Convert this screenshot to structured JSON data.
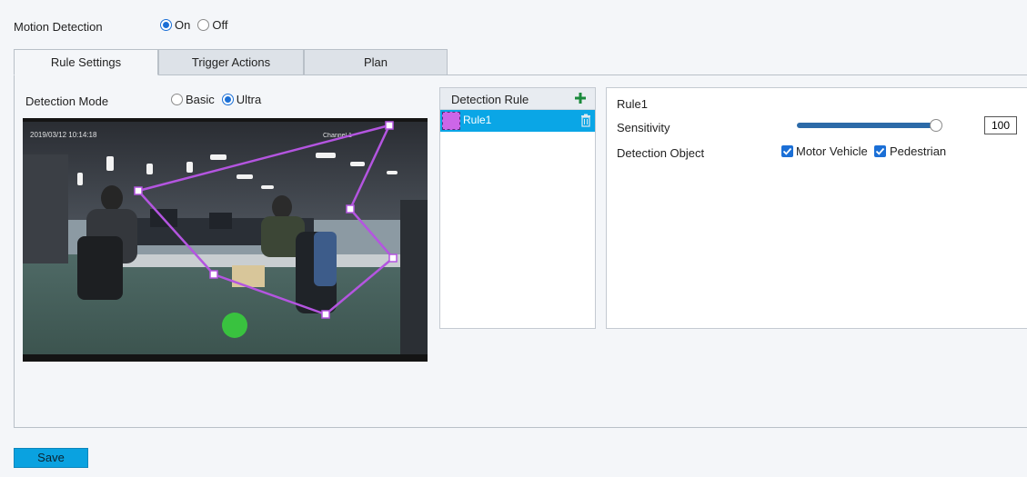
{
  "motion_detection": {
    "label": "Motion Detection",
    "options": [
      {
        "label": "On",
        "selected": true
      },
      {
        "label": "Off",
        "selected": false
      }
    ]
  },
  "tabs": [
    {
      "label": "Rule Settings",
      "active": true
    },
    {
      "label": "Trigger Actions",
      "active": false
    },
    {
      "label": "Plan",
      "active": false
    }
  ],
  "detection_mode": {
    "label": "Detection Mode",
    "options": [
      {
        "label": "Basic",
        "selected": false
      },
      {
        "label": "Ultra",
        "selected": true
      }
    ]
  },
  "rule_list": {
    "header": "Detection Rule",
    "add_icon": "plus-icon",
    "items": [
      {
        "label": "Rule1",
        "color": "#cc66e8",
        "selected": true,
        "delete_icon": "trash-icon"
      }
    ]
  },
  "rule_settings": {
    "rule_name": "Rule1",
    "sensitivity_label": "Sensitivity",
    "sensitivity_value": "100",
    "sensitivity_fraction": 1.0,
    "detection_object_label": "Detection Object",
    "objects": [
      {
        "label": "Motor Vehicle",
        "checked": true
      },
      {
        "label": "Pedestrian",
        "checked": true
      }
    ]
  },
  "save_label": "Save",
  "colors": {
    "accent": "#1b6fd6",
    "selection": "#0aa6e6",
    "rule_polygon": "#b455e0"
  }
}
